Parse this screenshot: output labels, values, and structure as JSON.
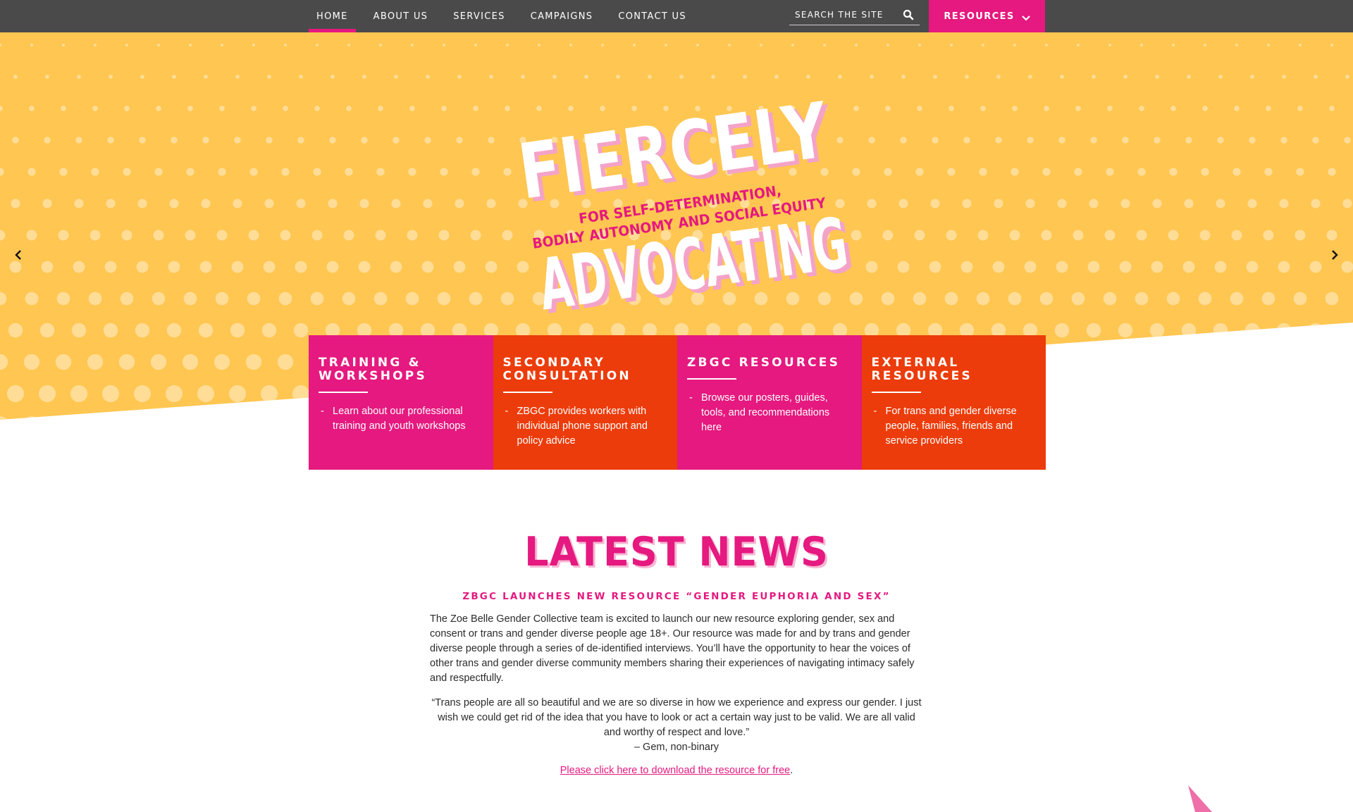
{
  "nav": {
    "items": [
      {
        "label": "HOME",
        "active": true
      },
      {
        "label": "ABOUT US",
        "active": false
      },
      {
        "label": "SERVICES",
        "active": false
      },
      {
        "label": "CAMPAIGNS",
        "active": false
      },
      {
        "label": "CONTACT US",
        "active": false
      }
    ],
    "search_placeholder": "SEARCH THE SITE",
    "resources_label": "RESOURCES"
  },
  "hero": {
    "logo_word1": "FIERCELY",
    "logo_word2": "ADVOCATING",
    "logo_tag1": "FOR SELF-DETERMINATION,",
    "logo_tag2": "BODILY AUTONOMY AND SOCIAL EQUITY"
  },
  "cards": [
    {
      "title": "TRAINING & WORKSHOPS",
      "desc": "Learn about our professional training and youth workshops"
    },
    {
      "title": "SECONDARY CONSULTATION",
      "desc": "ZBGC provides workers with individual phone support and policy advice"
    },
    {
      "title": "ZBGC RESOURCES",
      "desc": "Browse our posters, guides, tools, and recommendations here"
    },
    {
      "title": "EXTERNAL RESOURCES",
      "desc": "For trans and gender diverse people, families, friends and service providers"
    }
  ],
  "news": {
    "heading": "LATEST NEWS",
    "subheading": "ZBGC LAUNCHES NEW RESOURCE “GENDER EUPHORIA AND SEX”",
    "body": "The Zoe Belle Gender Collective team is excited to launch our new resource exploring gender, sex and consent or trans and gender diverse people age 18+. Our resource was made for and by trans and gender diverse people through a series of de-identified interviews. You’ll have the opportunity to hear the voices of other trans and gender diverse community members sharing their experiences of navigating intimacy safely and respectfully.",
    "quote": "“Trans people are all so beautiful and we are so diverse in how we experience and express our gender. I just wish we could get rid of the idea that you have to look or act a certain way just to be valid. We are all valid and worthy of respect and love.”",
    "attribution": "– Gem, non-binary",
    "link_text": "Please click here to download the resource for free",
    "link_suffix": "."
  },
  "colors": {
    "pink": "#e5197f",
    "orange": "#ec3c0b",
    "yellow": "#ffc651",
    "navbar": "#4a4a4b"
  },
  "icons": {
    "search": "search-icon",
    "dropdown": "chevron-down-icon",
    "prev": "chevron-left-icon",
    "next": "chevron-right-icon"
  }
}
